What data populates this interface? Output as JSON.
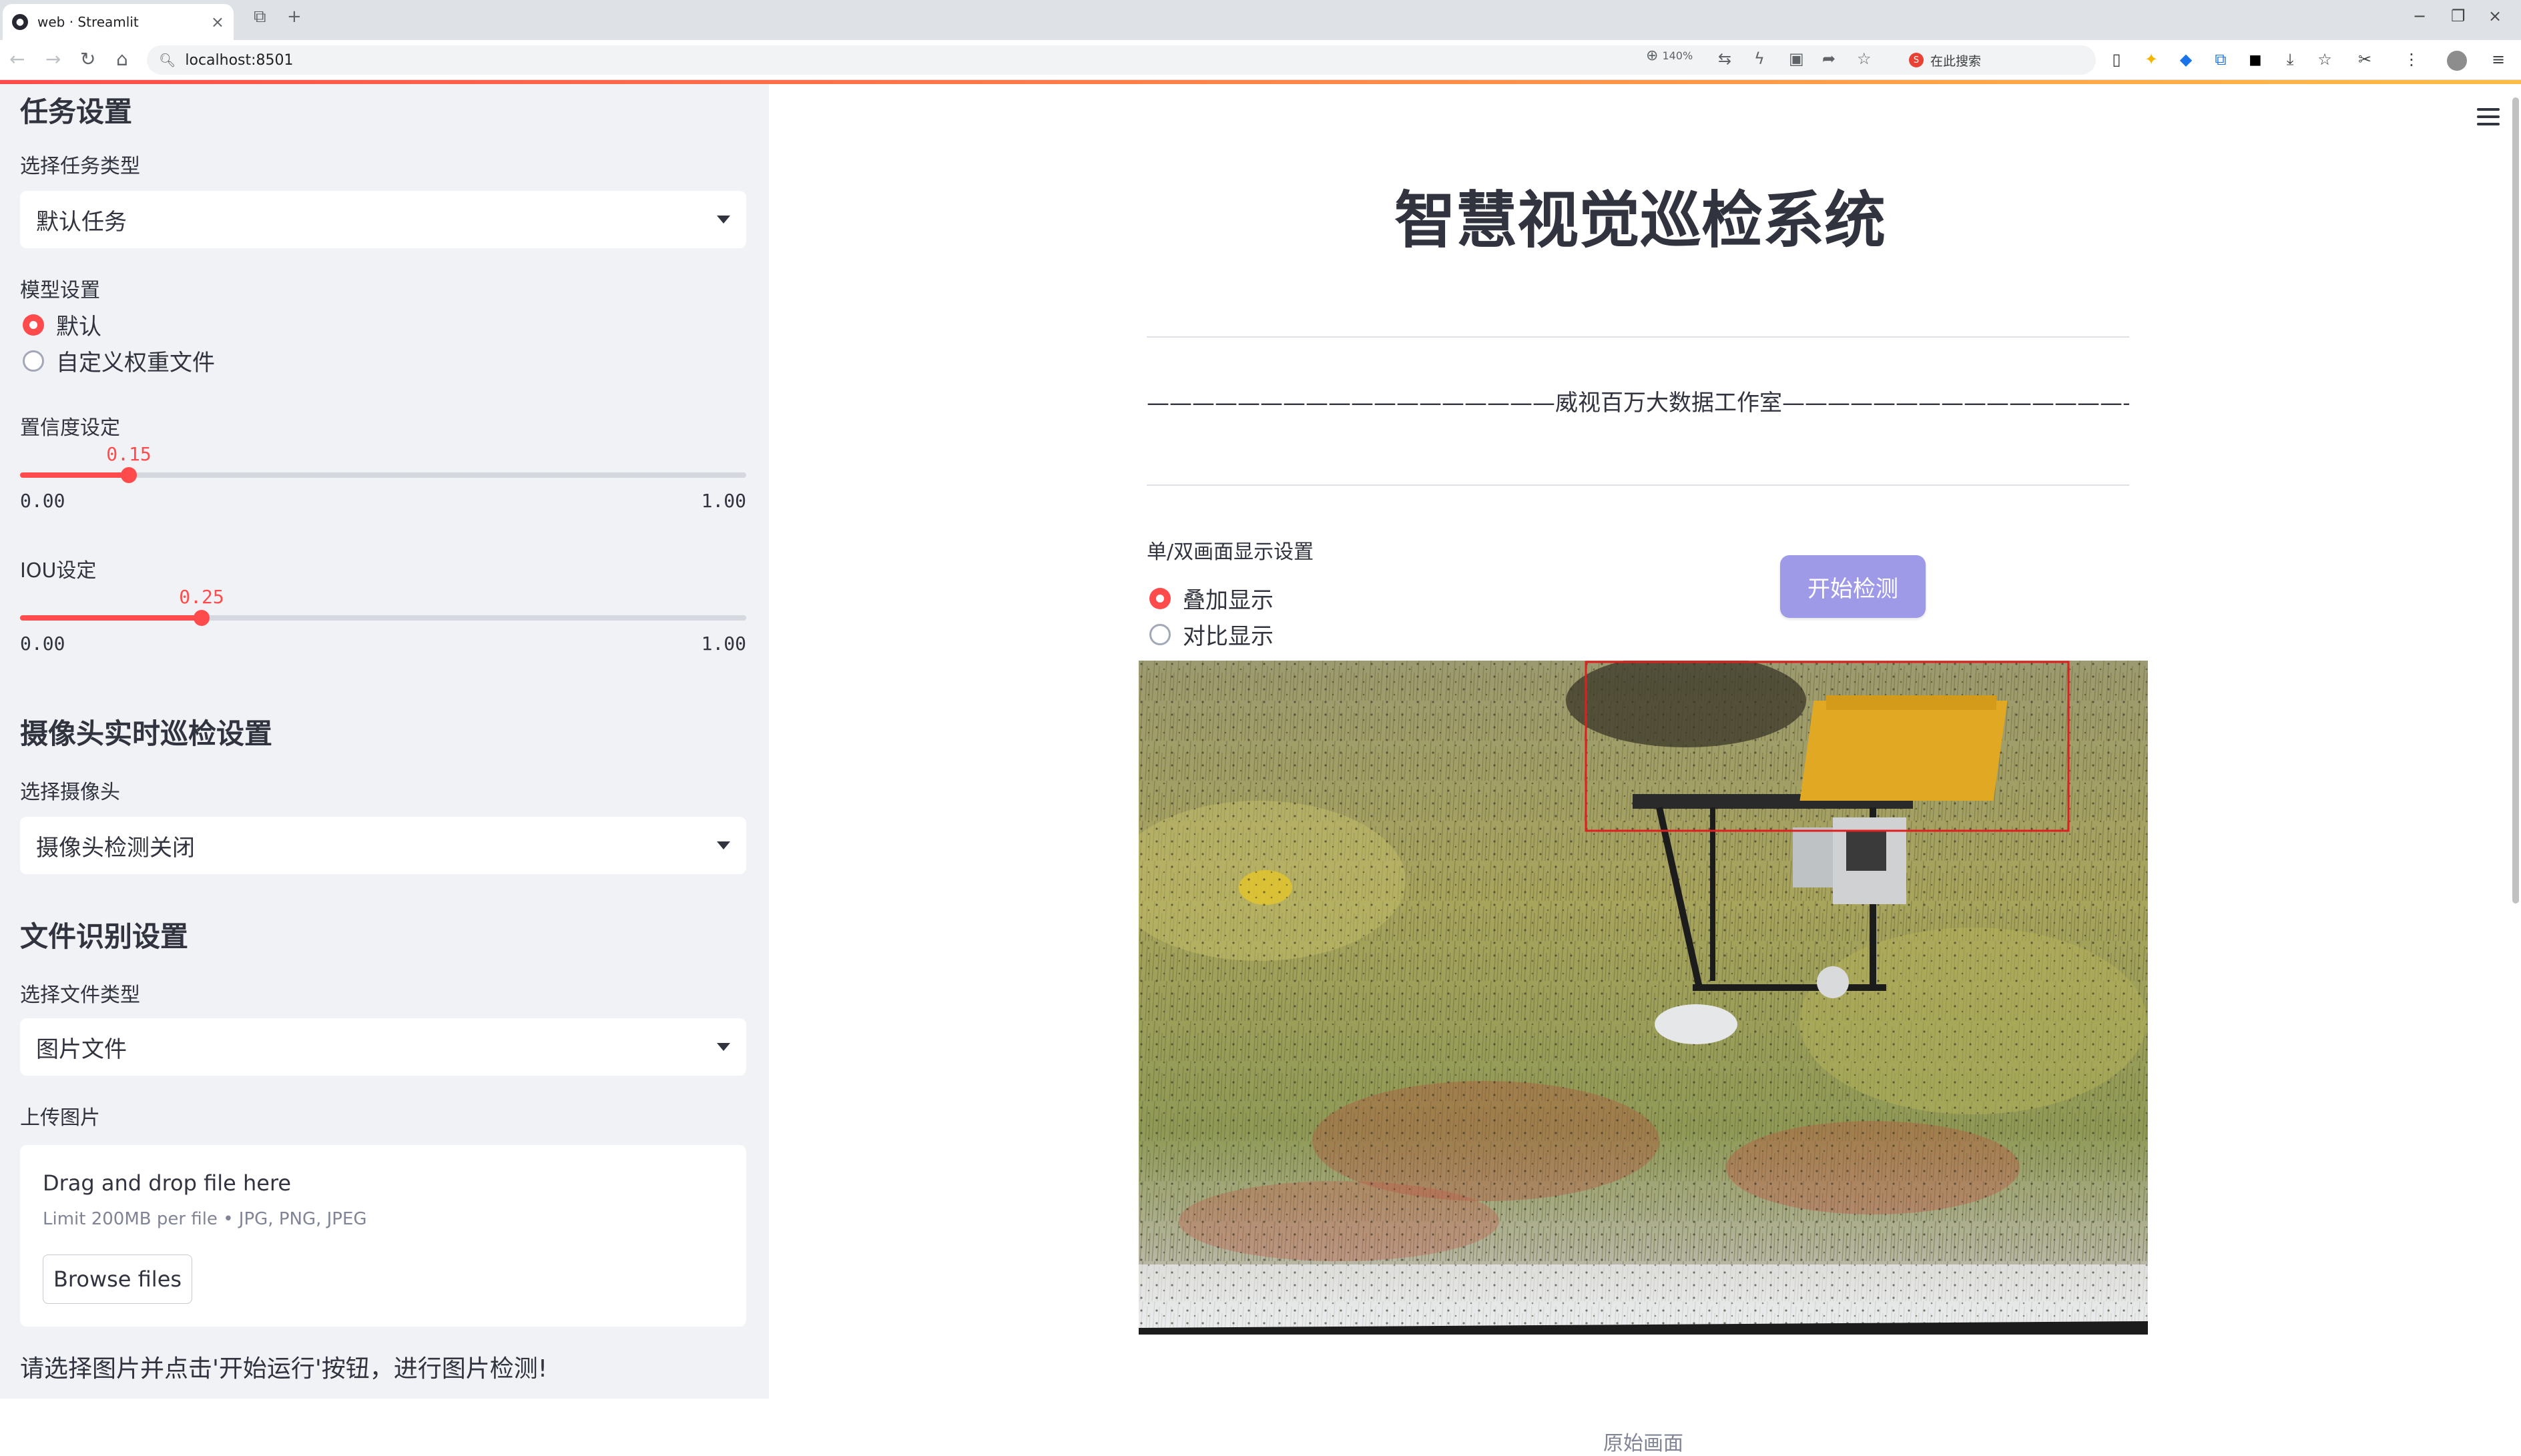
{
  "browser": {
    "tab_title": "web · Streamlit",
    "url": "localhost:8501",
    "zoom": "140%",
    "search_placeholder": "在此搜索"
  },
  "sidebar": {
    "task_section_title": "任务设置",
    "task_type_label": "选择任务类型",
    "task_type_value": "默认任务",
    "model_label": "模型设置",
    "model_options": [
      "默认",
      "自定义权重文件"
    ],
    "model_selected": 0,
    "conf_label": "置信度设定",
    "conf_value": "0.15",
    "conf_fraction": 0.15,
    "iou_label": "IOU设定",
    "iou_value": "0.25",
    "iou_fraction": 0.25,
    "slider_min": "0.00",
    "slider_max": "1.00",
    "camera_section_title": "摄像头实时巡检设置",
    "camera_label": "选择摄像头",
    "camera_value": "摄像头检测关闭",
    "file_section_title": "文件识别设置",
    "file_type_label": "选择文件类型",
    "file_type_value": "图片文件",
    "upload_label": "上传图片",
    "upload_main": "Drag and drop file here",
    "upload_sub": "Limit 200MB per file • JPG, PNG, JPEG",
    "browse_button": "Browse files",
    "note": "请选择图片并点击'开始运行'按钮，进行图片检测!"
  },
  "main": {
    "title": "智慧视觉巡检系统",
    "subtitle": "——————————————————威视百万大数据工作室——————————————————",
    "display_label": "单/双画面显示设置",
    "display_options": [
      "叠加显示",
      "对比显示"
    ],
    "display_selected": 0,
    "start_button": "开始检测",
    "image_caption": "原始画面"
  },
  "colors": {
    "accent": "#ff4b4b",
    "button": "#9f9ae8",
    "sidebar_bg": "#f0f2f6",
    "detection_box": "#e02020"
  }
}
